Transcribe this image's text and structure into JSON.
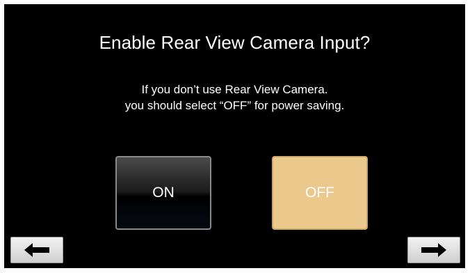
{
  "dialog": {
    "title": "Enable Rear View Camera Input?",
    "message_line1": "If you don’t use Rear View Camera.",
    "message_line2": "you should select “OFF” for power saving.",
    "options": [
      {
        "label": "ON",
        "selected": false
      },
      {
        "label": "OFF",
        "selected": true
      }
    ]
  },
  "navigation": {
    "back_icon": "arrow-left-icon",
    "next_icon": "arrow-right-icon"
  },
  "colors": {
    "background": "#000000",
    "selected_option": "#ebc98d",
    "text": "#ffffff"
  }
}
